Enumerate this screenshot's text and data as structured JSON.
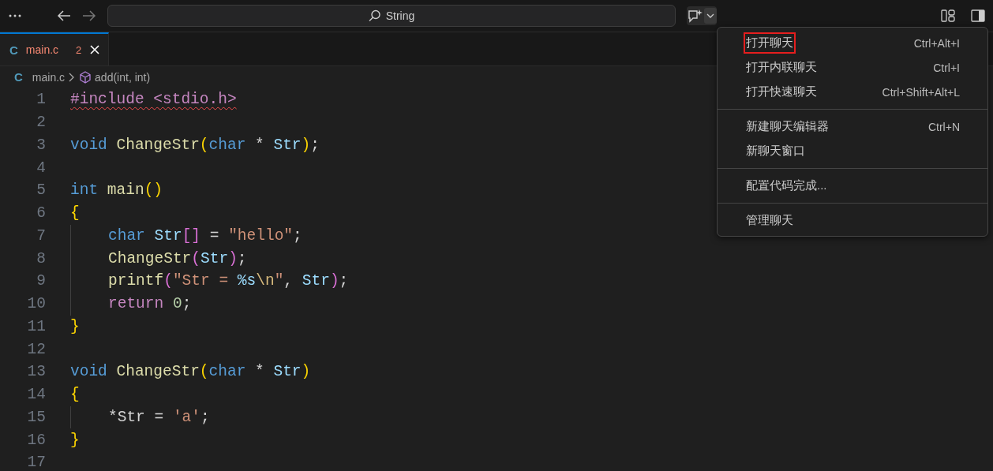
{
  "title_bar": {
    "search": {
      "value": "String"
    }
  },
  "tabs": [
    {
      "file_icon": "C",
      "label": "main.c",
      "problems": "2",
      "selected": true,
      "has_errors": true
    }
  ],
  "breadcrumbs": {
    "file_icon": "C",
    "file": "main.c",
    "symbol": "add(int, int)"
  },
  "editor": {
    "lines": [
      {
        "number": "1",
        "tokens": [
          {
            "text": "#include <stdio.h>",
            "kind": "directive",
            "error": true
          }
        ]
      },
      {
        "number": "2"
      },
      {
        "number": "3",
        "tokens": [
          {
            "text": "void ",
            "kind": "keyword"
          },
          {
            "text": "ChangeStr",
            "kind": "function"
          },
          {
            "text": "(",
            "kind": "bracket1"
          },
          {
            "text": "char",
            "kind": "keyword"
          },
          {
            "text": " * ",
            "kind": "plain"
          },
          {
            "text": "Str",
            "kind": "variable"
          },
          {
            "text": ")",
            "kind": "bracket1"
          },
          {
            "text": ";",
            "kind": "plain"
          }
        ]
      },
      {
        "number": "4"
      },
      {
        "number": "5",
        "tokens": [
          {
            "text": "int ",
            "kind": "keyword"
          },
          {
            "text": "main",
            "kind": "function"
          },
          {
            "text": "()",
            "kind": "bracket1"
          }
        ]
      },
      {
        "number": "6",
        "tokens": [
          {
            "text": "{",
            "kind": "bracket1"
          }
        ]
      },
      {
        "number": "7",
        "indented": true,
        "tokens": [
          {
            "text": "char ",
            "kind": "keyword"
          },
          {
            "text": "Str",
            "kind": "variable"
          },
          {
            "text": "[]",
            "kind": "bracket2"
          },
          {
            "text": " = ",
            "kind": "plain"
          },
          {
            "text": "\"hello\"",
            "kind": "string"
          },
          {
            "text": ";",
            "kind": "plain"
          }
        ]
      },
      {
        "number": "8",
        "indented": true,
        "tokens": [
          {
            "text": "ChangeStr",
            "kind": "function"
          },
          {
            "text": "(",
            "kind": "bracket2"
          },
          {
            "text": "Str",
            "kind": "variable"
          },
          {
            "text": ")",
            "kind": "bracket2"
          },
          {
            "text": ";",
            "kind": "plain"
          }
        ]
      },
      {
        "number": "9",
        "indented": true,
        "tokens": [
          {
            "text": "printf",
            "kind": "function"
          },
          {
            "text": "(",
            "kind": "bracket2"
          },
          {
            "text": "\"Str = ",
            "kind": "string"
          },
          {
            "text": "%s",
            "kind": "format"
          },
          {
            "text": "\\n",
            "kind": "escape"
          },
          {
            "text": "\"",
            "kind": "string"
          },
          {
            "text": ", ",
            "kind": "plain"
          },
          {
            "text": "Str",
            "kind": "variable"
          },
          {
            "text": ")",
            "kind": "bracket2"
          },
          {
            "text": ";",
            "kind": "plain"
          }
        ]
      },
      {
        "number": "10",
        "indented": true,
        "tokens": [
          {
            "text": "return ",
            "kind": "control"
          },
          {
            "text": "0",
            "kind": "number"
          },
          {
            "text": ";",
            "kind": "plain"
          }
        ]
      },
      {
        "number": "11",
        "tokens": [
          {
            "text": "}",
            "kind": "bracket1"
          }
        ]
      },
      {
        "number": "12"
      },
      {
        "number": "13",
        "tokens": [
          {
            "text": "void ",
            "kind": "keyword"
          },
          {
            "text": "ChangeStr",
            "kind": "function"
          },
          {
            "text": "(",
            "kind": "bracket1"
          },
          {
            "text": "char",
            "kind": "keyword"
          },
          {
            "text": " * ",
            "kind": "plain"
          },
          {
            "text": "Str",
            "kind": "variable"
          },
          {
            "text": ")",
            "kind": "bracket1"
          }
        ]
      },
      {
        "number": "14",
        "tokens": [
          {
            "text": "{",
            "kind": "bracket1"
          }
        ]
      },
      {
        "number": "15",
        "indented": true,
        "tokens": [
          {
            "text": "*Str = ",
            "kind": "plain"
          },
          {
            "text": "'a'",
            "kind": "string"
          },
          {
            "text": ";",
            "kind": "plain"
          }
        ]
      },
      {
        "number": "16",
        "tokens": [
          {
            "text": "}",
            "kind": "bracket1"
          }
        ]
      },
      {
        "number": "17"
      }
    ]
  },
  "chat_menu": {
    "groups": [
      [
        {
          "label": "打开聊天",
          "shortcut": "Ctrl+Alt+I",
          "highlighted": true
        },
        {
          "label": "打开内联聊天",
          "shortcut": "Ctrl+I",
          "highlighted": false
        },
        {
          "label": "打开快速聊天",
          "shortcut": "Ctrl+Shift+Alt+L",
          "highlighted": false
        }
      ],
      [
        {
          "label": "新建聊天编辑器",
          "shortcut": "Ctrl+N",
          "highlighted": false
        },
        {
          "label": "新聊天窗口",
          "highlighted": false
        }
      ],
      [
        {
          "label": "配置代码完成...",
          "highlighted": false
        }
      ],
      [
        {
          "label": "管理聊天",
          "highlighted": false
        }
      ]
    ]
  }
}
